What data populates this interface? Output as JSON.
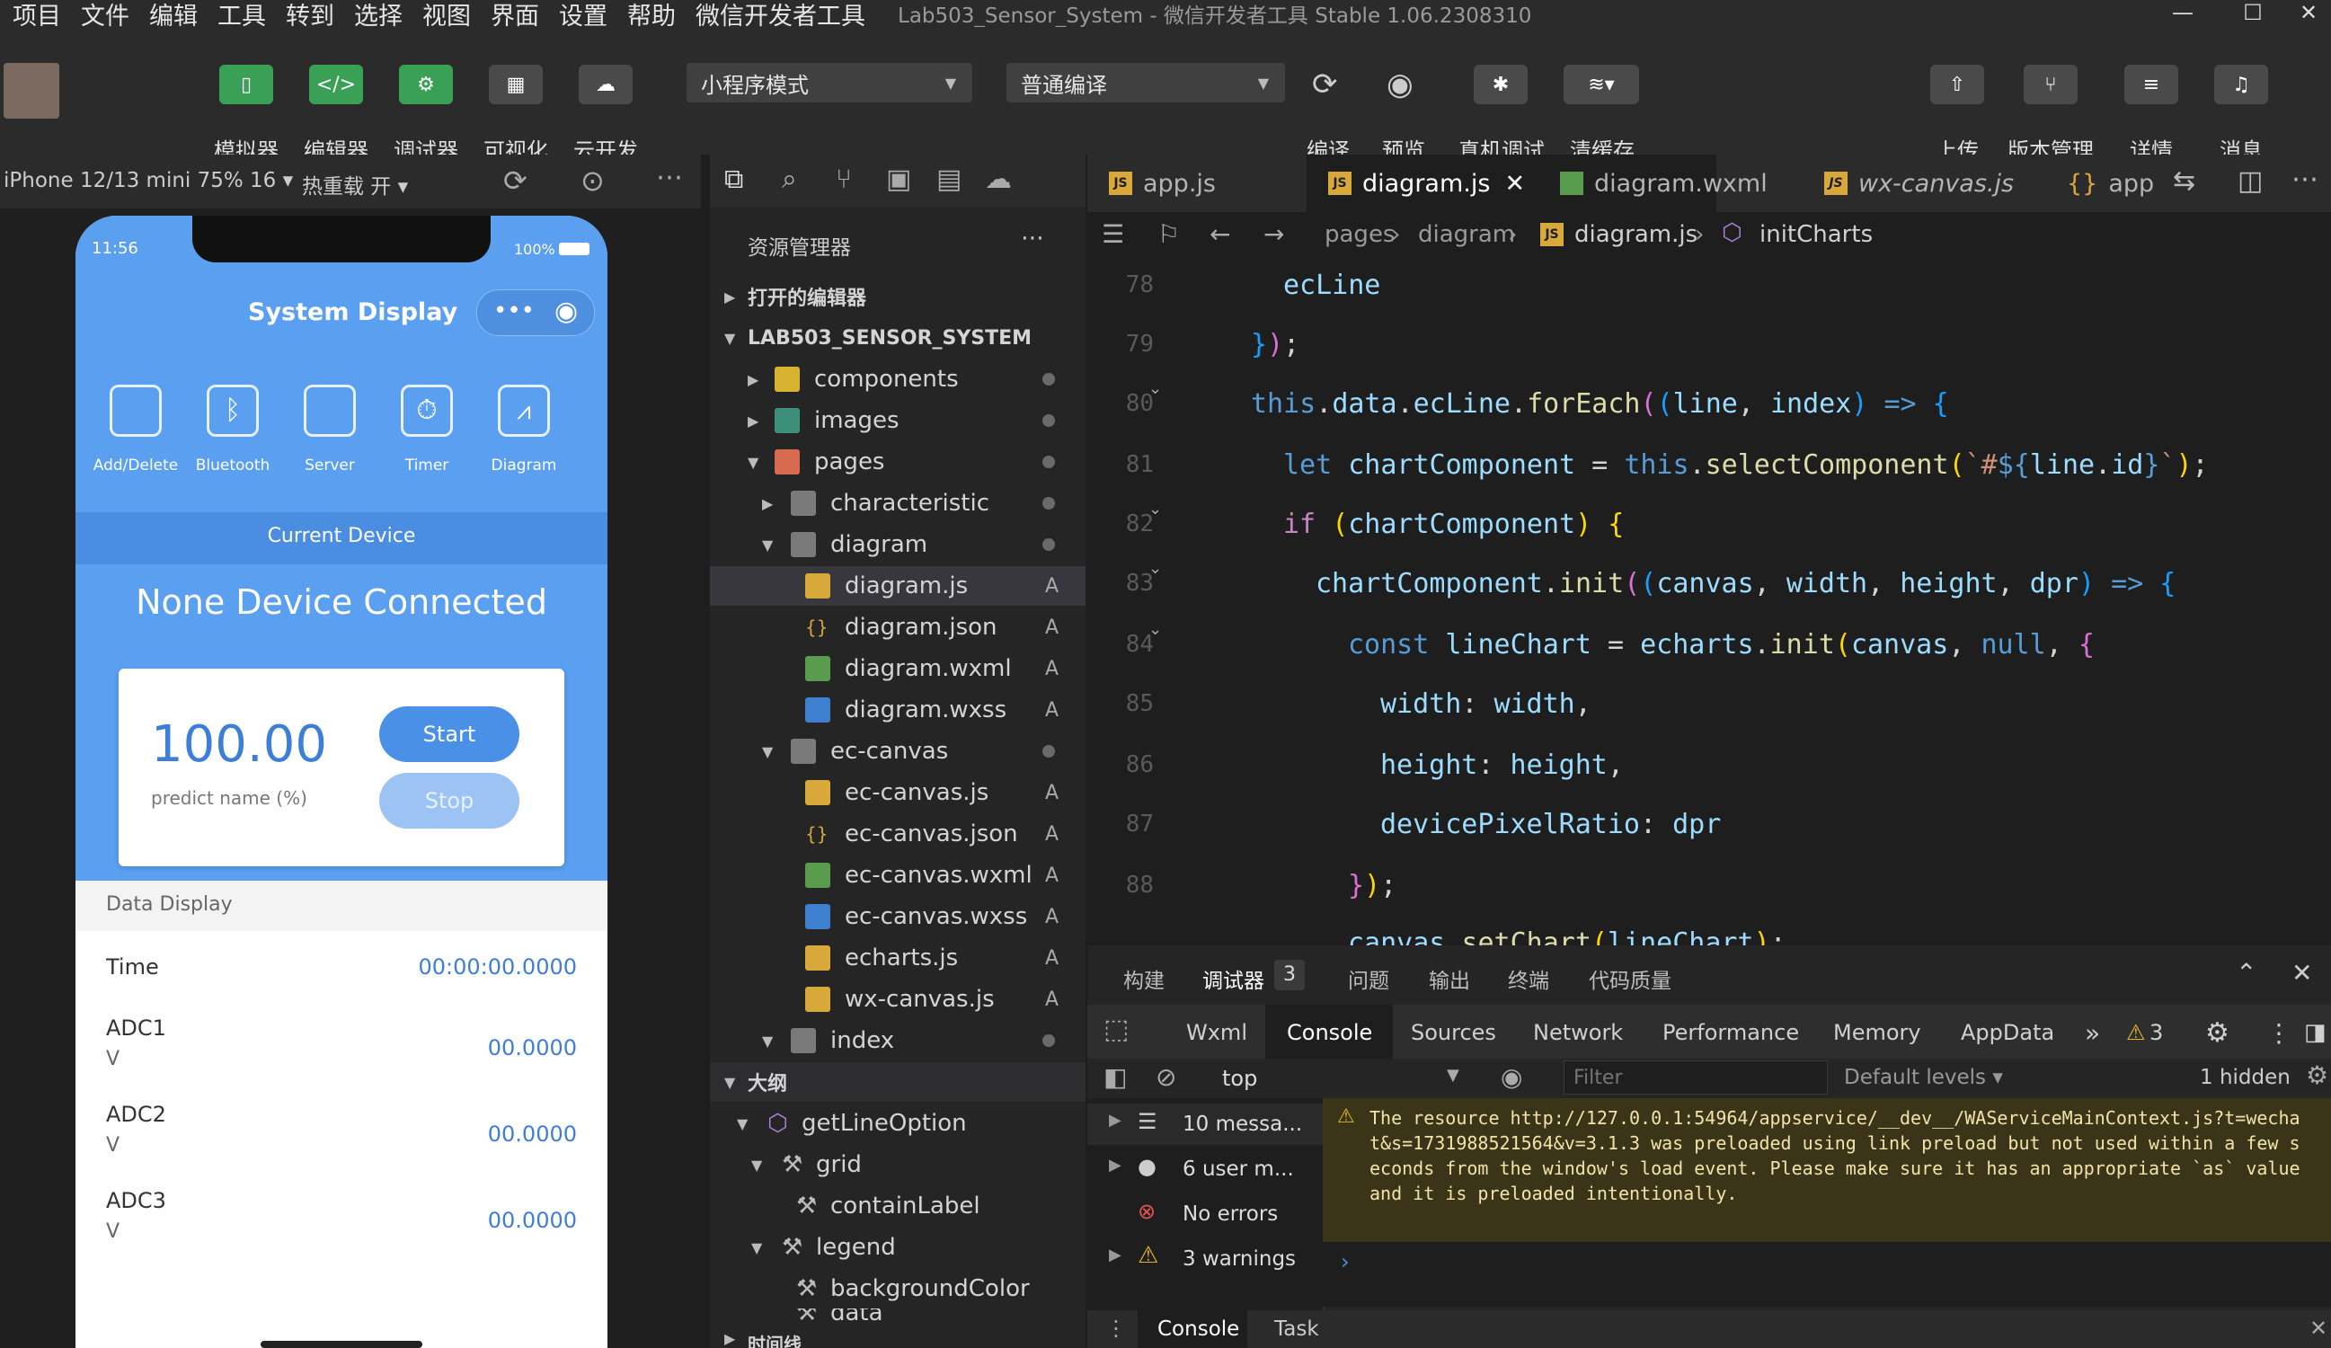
{
  "menubar": {
    "items": [
      "项目",
      "文件",
      "编辑",
      "工具",
      "转到",
      "选择",
      "视图",
      "界面",
      "设置",
      "帮助",
      "微信开发者工具"
    ],
    "title": "Lab503_Sensor_System - 微信开发者工具 Stable 1.06.2308310"
  },
  "toolbar": {
    "left_buttons": [
      "模拟器",
      "编辑器",
      "调试器",
      "可视化",
      "云开发"
    ],
    "mode_select": "小程序模式",
    "compile_select": "普通编译",
    "mid_buttons": [
      "编译",
      "预览",
      "真机调试",
      "清缓存"
    ],
    "right_buttons": [
      "上传",
      "版本管理",
      "详情",
      "消息"
    ]
  },
  "simulator": {
    "device": "iPhone 12/13 mini 75% 16 ▾",
    "hot_reload": "热重载 开 ▾"
  },
  "phone": {
    "time": "11:56",
    "battery": "100%",
    "title": "System Display",
    "nav": [
      "Add/Delete",
      "Bluetooth",
      "Server",
      "Timer",
      "Diagram"
    ],
    "current_device_label": "Current Device",
    "device_status": "None Device Connected",
    "value": "100.00",
    "value_label": "predict name (%)",
    "start": "Start",
    "stop": "Stop",
    "data_display": "Data Display",
    "rows": [
      {
        "label": "Time",
        "unit": "",
        "value": "00:00:00.0000"
      },
      {
        "label": "ADC1",
        "unit": "V",
        "value": "00.0000"
      },
      {
        "label": "ADC2",
        "unit": "V",
        "value": "00.0000"
      },
      {
        "label": "ADC3",
        "unit": "V",
        "value": "00.0000"
      }
    ]
  },
  "explorer": {
    "title": "资源管理器",
    "open_editors": "打开的编辑器",
    "project": "LAB503_SENSOR_SYSTEM",
    "tree": [
      {
        "name": "components",
        "status": "●"
      },
      {
        "name": "images",
        "status": "●"
      },
      {
        "name": "pages",
        "status": "●"
      },
      {
        "name": "characteristic",
        "status": "●"
      },
      {
        "name": "diagram",
        "status": "●"
      },
      {
        "name": "diagram.js",
        "status": "A"
      },
      {
        "name": "diagram.json",
        "status": "A"
      },
      {
        "name": "diagram.wxml",
        "status": "A"
      },
      {
        "name": "diagram.wxss",
        "status": "A"
      },
      {
        "name": "ec-canvas",
        "status": "●"
      },
      {
        "name": "ec-canvas.js",
        "status": "A"
      },
      {
        "name": "ec-canvas.json",
        "status": "A"
      },
      {
        "name": "ec-canvas.wxml",
        "status": "A"
      },
      {
        "name": "ec-canvas.wxss",
        "status": "A"
      },
      {
        "name": "echarts.js",
        "status": "A"
      },
      {
        "name": "wx-canvas.js",
        "status": "A"
      },
      {
        "name": "index",
        "status": "●"
      }
    ],
    "outline_title": "大纲",
    "outline": [
      "getLineOption",
      "grid",
      "containLabel",
      "legend",
      "backgroundColor",
      "data"
    ],
    "timeline": "时间线"
  },
  "editor": {
    "tabs": [
      "app.js",
      "diagram.js",
      "diagram.wxml",
      "wx-canvas.js",
      "app"
    ],
    "breadcrumb": [
      "pages",
      "diagram",
      "diagram.js",
      "initCharts"
    ],
    "line_numbers": [
      "78",
      "79",
      "80",
      "81",
      "82",
      "83",
      "84",
      "85",
      "86",
      "87",
      "88"
    ]
  },
  "panel": {
    "top_tabs": [
      "构建",
      "调试器",
      "问题",
      "输出",
      "终端",
      "代码质量"
    ],
    "debugger_count": "3",
    "devtools_tabs": [
      "Wxml",
      "Console",
      "Sources",
      "Network",
      "Performance",
      "Memory",
      "AppData"
    ],
    "warning_count": "3",
    "context": "top",
    "filter_placeholder": "Filter",
    "levels": "Default levels ▾",
    "hidden": "1 hidden",
    "sidebar": [
      "10 messa...",
      "6 user m...",
      "No errors",
      "3 warnings"
    ],
    "message_text": "The resource http://127.0.0.1:54964/appservice/__dev__/WAServiceMainContext.js?t=wechat&s=1731988521564&v=3.1.3 was preloaded using link preload but not used within a few seconds from the window's load event. Please make sure it has an appropriate `as` value and it is preloaded intentionally.",
    "bottom_tabs": [
      "Console",
      "Task"
    ]
  }
}
